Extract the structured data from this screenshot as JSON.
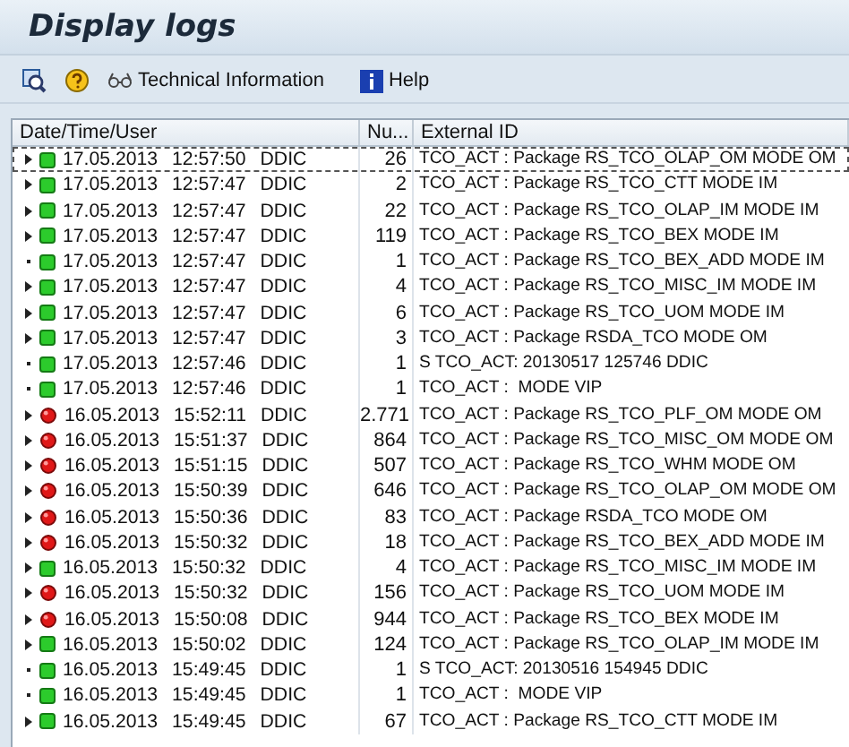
{
  "window": {
    "title": "Display logs"
  },
  "toolbar": [
    {
      "kind": "detail"
    },
    {
      "kind": "help-circle"
    },
    {
      "kind": "glasses",
      "label": "Technical Information"
    },
    {
      "kind": "info",
      "label": "Help"
    }
  ],
  "table": {
    "columns": [
      "Date/Time/User",
      "Nu...",
      "External ID"
    ],
    "rows": [
      {
        "expandable": true,
        "selected": true,
        "kind": "ok",
        "date": "17.05.2013",
        "time": "12:57:50",
        "user": "DDIC",
        "number": "26",
        "external_id": "TCO_ACT : Package RS_TCO_OLAP_OM MODE OM"
      },
      {
        "expandable": true,
        "selected": false,
        "kind": "ok",
        "date": "17.05.2013",
        "time": "12:57:47",
        "user": "DDIC",
        "number": "2",
        "external_id": "TCO_ACT : Package RS_TCO_CTT MODE IM"
      },
      {
        "expandable": true,
        "selected": false,
        "kind": "ok",
        "date": "17.05.2013",
        "time": "12:57:47",
        "user": "DDIC",
        "number": "22",
        "external_id": "TCO_ACT : Package RS_TCO_OLAP_IM MODE IM"
      },
      {
        "expandable": true,
        "selected": false,
        "kind": "ok",
        "date": "17.05.2013",
        "time": "12:57:47",
        "user": "DDIC",
        "number": "119",
        "external_id": "TCO_ACT : Package RS_TCO_BEX MODE IM"
      },
      {
        "expandable": false,
        "selected": false,
        "kind": "ok",
        "date": "17.05.2013",
        "time": "12:57:47",
        "user": "DDIC",
        "number": "1",
        "external_id": "TCO_ACT : Package RS_TCO_BEX_ADD MODE IM"
      },
      {
        "expandable": true,
        "selected": false,
        "kind": "ok",
        "date": "17.05.2013",
        "time": "12:57:47",
        "user": "DDIC",
        "number": "4",
        "external_id": "TCO_ACT : Package RS_TCO_MISC_IM MODE IM"
      },
      {
        "expandable": true,
        "selected": false,
        "kind": "ok",
        "date": "17.05.2013",
        "time": "12:57:47",
        "user": "DDIC",
        "number": "6",
        "external_id": "TCO_ACT : Package RS_TCO_UOM MODE IM"
      },
      {
        "expandable": true,
        "selected": false,
        "kind": "ok",
        "date": "17.05.2013",
        "time": "12:57:47",
        "user": "DDIC",
        "number": "3",
        "external_id": "TCO_ACT : Package RSDA_TCO MODE OM"
      },
      {
        "expandable": false,
        "selected": false,
        "kind": "ok",
        "date": "17.05.2013",
        "time": "12:57:46",
        "user": "DDIC",
        "number": "1",
        "external_id": "S TCO_ACT: 20130517 125746 DDIC"
      },
      {
        "expandable": false,
        "selected": false,
        "kind": "ok",
        "date": "17.05.2013",
        "time": "12:57:46",
        "user": "DDIC",
        "number": "1",
        "external_id": "TCO_ACT :  MODE VIP"
      },
      {
        "expandable": true,
        "selected": false,
        "kind": "error",
        "date": "16.05.2013",
        "time": "15:52:11",
        "user": "DDIC",
        "number": "2.771",
        "external_id": "TCO_ACT : Package RS_TCO_PLF_OM MODE OM"
      },
      {
        "expandable": true,
        "selected": false,
        "kind": "error",
        "date": "16.05.2013",
        "time": "15:51:37",
        "user": "DDIC",
        "number": "864",
        "external_id": "TCO_ACT : Package RS_TCO_MISC_OM MODE OM"
      },
      {
        "expandable": true,
        "selected": false,
        "kind": "error",
        "date": "16.05.2013",
        "time": "15:51:15",
        "user": "DDIC",
        "number": "507",
        "external_id": "TCO_ACT : Package RS_TCO_WHM MODE OM"
      },
      {
        "expandable": true,
        "selected": false,
        "kind": "error",
        "date": "16.05.2013",
        "time": "15:50:39",
        "user": "DDIC",
        "number": "646",
        "external_id": "TCO_ACT : Package RS_TCO_OLAP_OM MODE OM"
      },
      {
        "expandable": true,
        "selected": false,
        "kind": "error",
        "date": "16.05.2013",
        "time": "15:50:36",
        "user": "DDIC",
        "number": "83",
        "external_id": "TCO_ACT : Package RSDA_TCO MODE OM"
      },
      {
        "expandable": true,
        "selected": false,
        "kind": "error",
        "date": "16.05.2013",
        "time": "15:50:32",
        "user": "DDIC",
        "number": "18",
        "external_id": "TCO_ACT : Package RS_TCO_BEX_ADD MODE IM"
      },
      {
        "expandable": true,
        "selected": false,
        "kind": "ok",
        "date": "16.05.2013",
        "time": "15:50:32",
        "user": "DDIC",
        "number": "4",
        "external_id": "TCO_ACT : Package RS_TCO_MISC_IM MODE IM"
      },
      {
        "expandable": true,
        "selected": false,
        "kind": "error",
        "date": "16.05.2013",
        "time": "15:50:32",
        "user": "DDIC",
        "number": "156",
        "external_id": "TCO_ACT : Package RS_TCO_UOM MODE IM"
      },
      {
        "expandable": true,
        "selected": false,
        "kind": "error",
        "date": "16.05.2013",
        "time": "15:50:08",
        "user": "DDIC",
        "number": "944",
        "external_id": "TCO_ACT : Package RS_TCO_BEX MODE IM"
      },
      {
        "expandable": true,
        "selected": false,
        "kind": "ok",
        "date": "16.05.2013",
        "time": "15:50:02",
        "user": "DDIC",
        "number": "124",
        "external_id": "TCO_ACT : Package RS_TCO_OLAP_IM MODE IM"
      },
      {
        "expandable": false,
        "selected": false,
        "kind": "ok",
        "date": "16.05.2013",
        "time": "15:49:45",
        "user": "DDIC",
        "number": "1",
        "external_id": "S TCO_ACT: 20130516 154945 DDIC"
      },
      {
        "expandable": false,
        "selected": false,
        "kind": "ok",
        "date": "16.05.2013",
        "time": "15:49:45",
        "user": "DDIC",
        "number": "1",
        "external_id": "TCO_ACT :  MODE VIP"
      },
      {
        "expandable": true,
        "selected": false,
        "kind": "ok",
        "date": "16.05.2013",
        "time": "15:49:45",
        "user": "DDIC",
        "number": "67",
        "external_id": "TCO_ACT : Package RS_TCO_CTT MODE IM"
      }
    ]
  }
}
